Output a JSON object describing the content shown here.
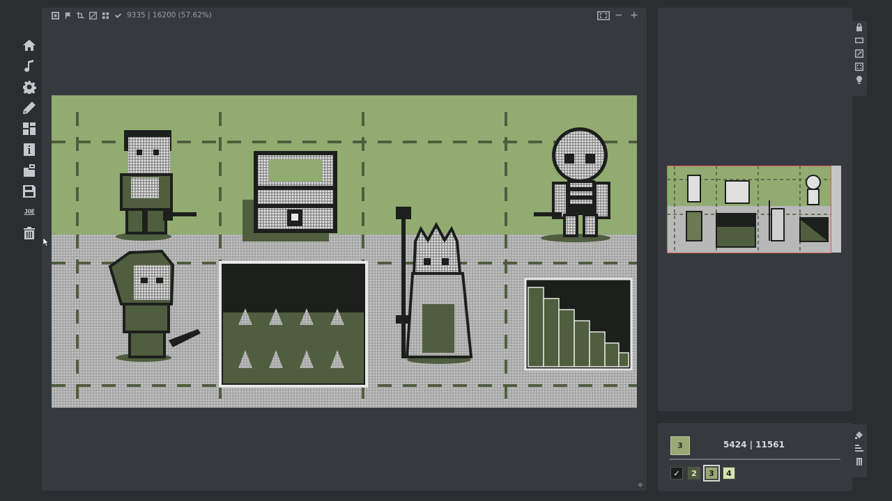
{
  "topbar": {
    "stats": "9335 | 16200 (57.62%)",
    "icons": [
      "frame-icon",
      "flag-icon",
      "crop-icon",
      "hatch-icon",
      "layers-icon",
      "check-icon"
    ],
    "right_icons": [
      "fit-screen-icon",
      "zoom-out-icon",
      "zoom-in-icon"
    ],
    "zoom_out": "−",
    "zoom_in": "+"
  },
  "sidebar": {
    "items": [
      {
        "name": "home-icon"
      },
      {
        "name": "music-icon"
      },
      {
        "name": "gear-icon"
      },
      {
        "name": "pencil-icon"
      },
      {
        "name": "dashboard-icon"
      },
      {
        "name": "info-icon"
      },
      {
        "name": "import-icon"
      },
      {
        "name": "save-icon"
      },
      {
        "name": "joe-text",
        "label": "JOE"
      },
      {
        "name": "trash-icon"
      }
    ]
  },
  "right_tools": [
    "lock-icon",
    "rectangle-icon",
    "expand-icon",
    "fullscreen-icon",
    "bulb-icon"
  ],
  "bottom_tools": [
    "fill-icon",
    "align-icon",
    "text-icon"
  ],
  "selection": {
    "current_color": "3",
    "coords": "5424  |  11561"
  },
  "palette": [
    {
      "label": "✓",
      "color": "#1c1f1c",
      "text": "#ffffff"
    },
    {
      "label": "2",
      "color": "#4e5b3c",
      "text": "#e3e6da"
    },
    {
      "label": "3",
      "color": "#9aa874",
      "text": "#1c1f1c"
    },
    {
      "label": "4",
      "color": "#d7e3ad",
      "text": "#1c1f1c"
    }
  ],
  "colors": {
    "dark": "#1c1f1c",
    "mid": "#4f5e3e",
    "light": "#92ab71",
    "pale": "#b0b0b0",
    "accent": "#e05b5b"
  }
}
